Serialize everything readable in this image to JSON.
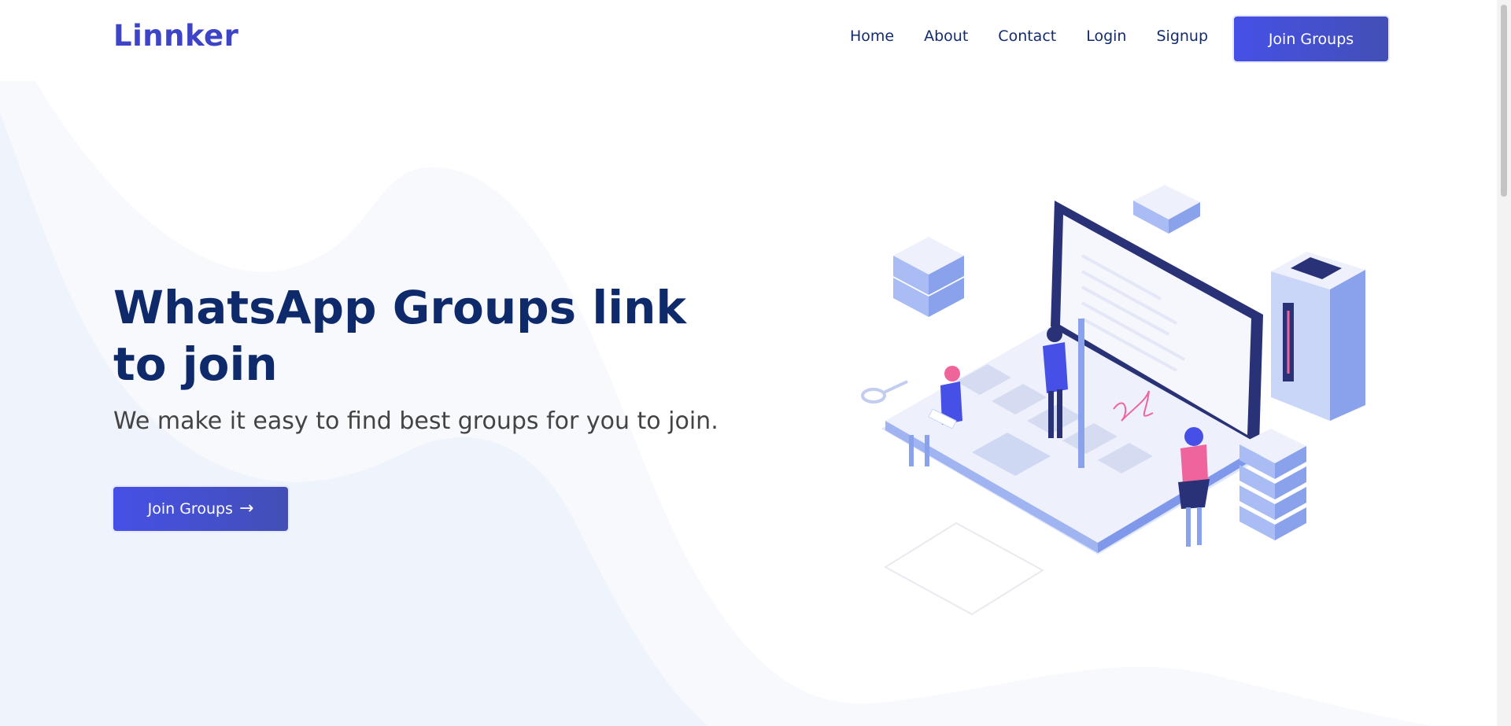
{
  "brand": {
    "name": "Linnker"
  },
  "nav": {
    "items": [
      "Home",
      "About",
      "Contact",
      "Login",
      "Signup"
    ],
    "cta_label": "Join Groups"
  },
  "hero": {
    "title": "WhatsApp Groups link to join",
    "subtitle": "We make it easy to find best groups for you to join.",
    "cta_label": "Join Groups",
    "cta_icon": "arrow-right-icon"
  },
  "colors": {
    "brand": "#3d44c8",
    "heading": "#0f2a6b",
    "button_start": "#4650e6",
    "button_end": "#434fb6",
    "hero_bg": "#eff3fb"
  }
}
